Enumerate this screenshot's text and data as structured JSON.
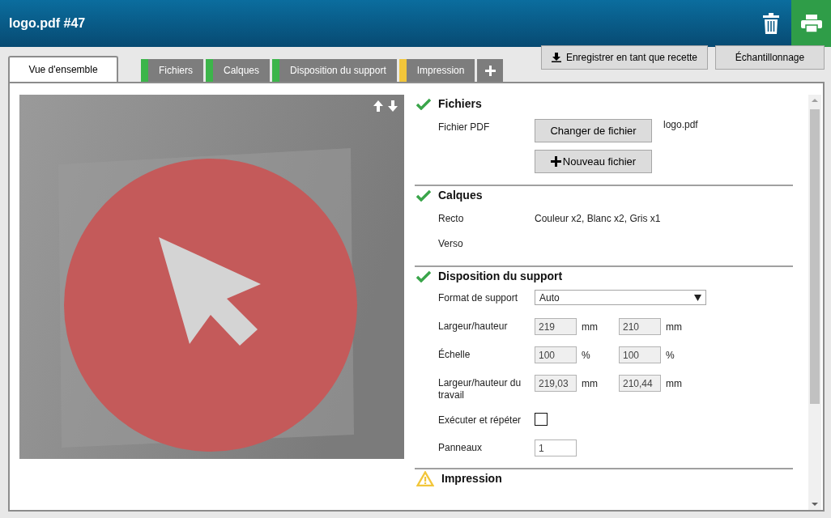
{
  "header": {
    "title": "logo.pdf #47"
  },
  "tabs": [
    {
      "label": "Vue d'ensemble",
      "selected": true
    },
    {
      "label": "Fichiers",
      "selected": false,
      "color": "#3cb54a"
    },
    {
      "label": "Calques",
      "selected": false,
      "color": "#3cb54a"
    },
    {
      "label": "Disposition du support",
      "selected": false,
      "color": "#3cb54a"
    },
    {
      "label": "Impression",
      "selected": false,
      "color": "#f2c63a"
    }
  ],
  "toolbar_buttons": [
    {
      "label": "Enregistrer en tant que recette",
      "kind": "download"
    },
    {
      "label": "Échantillonnage",
      "kind": "plain"
    }
  ],
  "sections": [
    {
      "title": "Fichiers",
      "kind": "ok",
      "rows": [
        {
          "kind": "file",
          "label": "Fichier PDF",
          "button": "Changer de fichier",
          "value": "logo.pdf"
        },
        {
          "kind": "add",
          "button": "Nouveau fichier"
        }
      ]
    },
    {
      "title": "Calques",
      "kind": "ok",
      "rows": [
        {
          "kind": "text",
          "label": "Recto",
          "value": "Couleur x2, Blanc x2, Gris x1"
        },
        {
          "kind": "text",
          "label": "Verso"
        }
      ]
    },
    {
      "title": "Disposition du support",
      "kind": "ok",
      "rows": [
        {
          "kind": "select",
          "label": "Format de support",
          "value": "Auto"
        },
        {
          "kind": "pair",
          "label": "Largeur/hauteur",
          "fields": [
            {
              "value": "219",
              "unit": "mm",
              "disabled": true
            },
            {
              "value": "210",
              "unit": "mm",
              "disabled": true
            }
          ]
        },
        {
          "kind": "pair",
          "label": "Échelle",
          "fields": [
            {
              "value": "100",
              "unit": "%",
              "disabled": true
            },
            {
              "value": "100",
              "unit": "%",
              "disabled": true
            }
          ]
        },
        {
          "kind": "pair",
          "label": "Largeur/hauteur du travail",
          "fields": [
            {
              "value": "219,03",
              "unit": "mm",
              "disabled": true
            },
            {
              "value": "210,44",
              "unit": "mm",
              "disabled": true
            }
          ]
        },
        {
          "kind": "checkbox",
          "label": "Exécuter et répéter",
          "checked": false
        },
        {
          "kind": "input",
          "label": "Panneaux",
          "value": "1"
        }
      ]
    },
    {
      "title": "Impression",
      "kind": "warning"
    }
  ]
}
